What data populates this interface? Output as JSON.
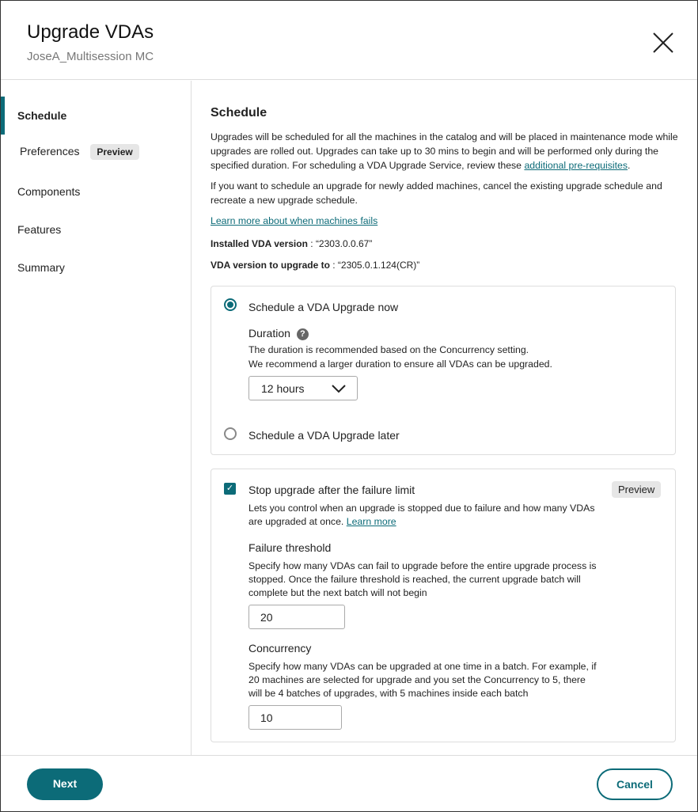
{
  "header": {
    "title": "Upgrade VDAs",
    "subtitle": "JoseA_Multisession MC"
  },
  "sidebar": {
    "items": [
      {
        "label": "Schedule",
        "active": true
      },
      {
        "label": "Preferences",
        "badge": "Preview"
      },
      {
        "label": "Components"
      },
      {
        "label": "Features"
      },
      {
        "label": "Summary"
      }
    ]
  },
  "main": {
    "heading": "Schedule",
    "intro": "Upgrades will be scheduled for all the machines in the catalog and will be placed in maintenance mode while upgrades are rolled out. Upgrades can take up to 30 mins to begin and will be performed only during the specified duration. For scheduling a VDA Upgrade Service, review these ",
    "intro_link": "additional pre-requisites",
    "intro_end": ".",
    "note": "If you want to schedule an upgrade for newly added machines, cancel the existing upgrade schedule and recreate a new upgrade schedule.",
    "learn_link": "Learn more about when machines fails",
    "installed_label": "Installed VDA version",
    "installed_value": " : “2303.0.0.67”",
    "target_label": "VDA version to upgrade to",
    "target_value": " : “2305.0.1.124(CR)”",
    "schedule_card": {
      "now_label": "Schedule a VDA Upgrade now",
      "now_selected": true,
      "duration_label": "Duration",
      "duration_help": "?",
      "duration_desc1": "The duration is recommended based on the Concurrency setting.",
      "duration_desc2": "We recommend a larger duration to ensure all VDAs can be upgraded.",
      "duration_value": "12 hours",
      "later_label": "Schedule a VDA Upgrade later"
    },
    "failure_card": {
      "checked": true,
      "title": "Stop upgrade after the failure limit",
      "badge": "Preview",
      "desc": "Lets you control when an upgrade is stopped due to failure and how many VDAs are upgraded at once. ",
      "desc_link": "Learn more",
      "threshold_label": "Failure threshold",
      "threshold_desc": "Specify how many VDAs can fail to upgrade before the entire upgrade process is stopped. Once the failure threshold is reached, the current upgrade batch will complete but the next batch will not begin",
      "threshold_value": "20",
      "concurrency_label": "Concurrency",
      "concurrency_desc": "Specify how many VDAs can be upgraded at one time in a batch. For example, if 20 machines are selected for upgrade and you set the Concurrency to 5, there will be 4 batches of upgrades, with 5 machines inside each batch",
      "concurrency_value": "10"
    }
  },
  "footer": {
    "next": "Next",
    "cancel": "Cancel"
  },
  "colors": {
    "accent": "#0c6b78"
  }
}
